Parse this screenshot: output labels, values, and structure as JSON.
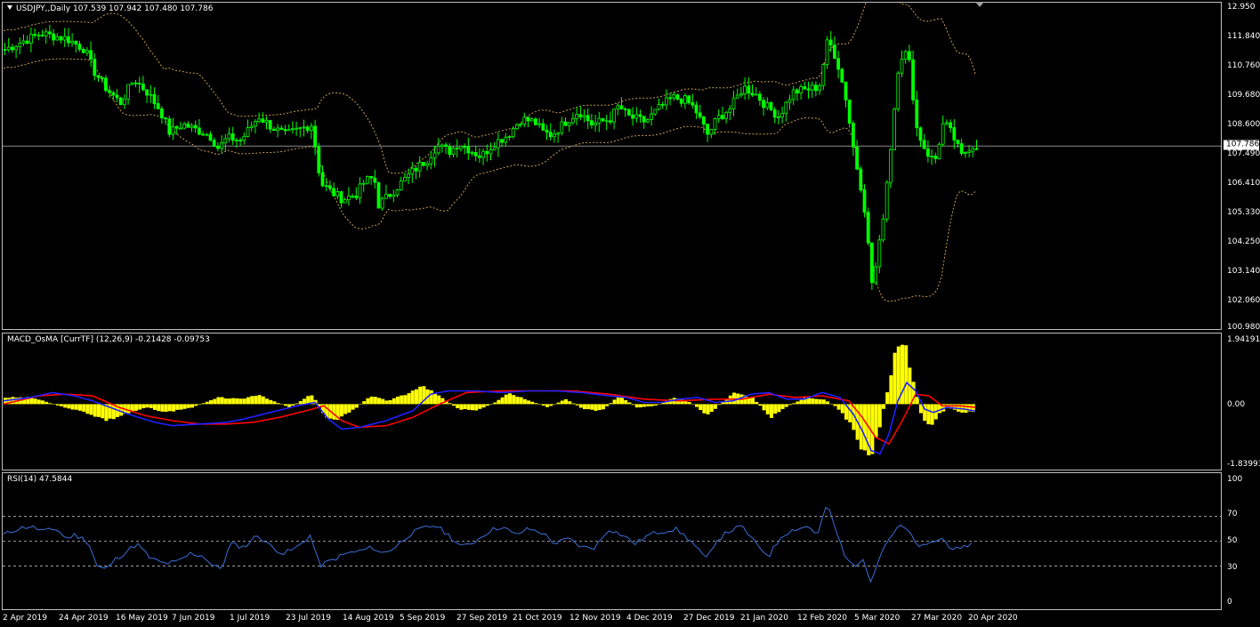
{
  "colors": {
    "background": "#000000",
    "frame": "#c0c0c0",
    "candle": "#00ff00",
    "bands": "#c8a050",
    "price_line": "#8a8a8a",
    "histogram": "#ffff00",
    "macd_line": "#2020ff",
    "signal_line": "#ff0000",
    "rsi_line": "#3a6fd8",
    "rsi_levels": "#c0c0c0"
  },
  "icons": {
    "symbol_menu": "triangle-down-icon",
    "chart_shift": "triangle-down-icon"
  },
  "main": {
    "title": "USDJPY,,Daily  107.539 107.942 107.480 107.786",
    "y_ticks": [
      "12.950",
      "111.840",
      "110.760",
      "109.680",
      "108.600",
      "107.490",
      "106.410",
      "105.330",
      "104.250",
      "103.140",
      "102.060",
      "100.980"
    ],
    "current_price": "107.786"
  },
  "macd": {
    "title": "MACD_OsMA [CurrTF] (12,26,9) -0.21428 -0.09753",
    "y_ticks": [
      "1.94191",
      "0.00",
      "-1.83993"
    ]
  },
  "rsi": {
    "title": "RSI(14) 47.5844",
    "y_ticks": [
      "100",
      "70",
      "50",
      "30",
      "0"
    ]
  },
  "x_ticks": [
    "2 Apr 2019",
    "24 Apr 2019",
    "16 May 2019",
    "7 Jun 2019",
    "1 Jul 2019",
    "23 Jul 2019",
    "14 Aug 2019",
    "5 Sep 2019",
    "27 Sep 2019",
    "21 Oct 2019",
    "12 Nov 2019",
    "4 Dec 2019",
    "27 Dec 2019",
    "21 Jan 2020",
    "12 Feb 2020",
    "5 Mar 2020",
    "27 Mar 2020",
    "20 Apr 2020"
  ],
  "chart_data": [
    {
      "type": "candlestick",
      "title": "USDJPY,,Daily  107.539 107.942 107.480 107.786",
      "symbol": "USDJPY",
      "timeframe": "Daily",
      "last_bar": {
        "open": 107.539,
        "high": 107.942,
        "low": 107.48,
        "close": 107.786
      },
      "ylim": [
        100.98,
        112.95
      ],
      "bollinger_bands": true,
      "x": [
        "2 Apr 2019",
        "24 Apr 2019",
        "16 May 2019",
        "7 Jun 2019",
        "1 Jul 2019",
        "23 Jul 2019",
        "14 Aug 2019",
        "5 Sep 2019",
        "27 Sep 2019",
        "21 Oct 2019",
        "12 Nov 2019",
        "4 Dec 2019",
        "27 Dec 2019",
        "21 Jan 2020",
        "12 Feb 2020",
        "5 Mar 2020",
        "27 Mar 2020",
        "20 Apr 2020"
      ],
      "close_approx": [
        111.5,
        111.9,
        110.2,
        108.4,
        108.5,
        108.2,
        106.2,
        106.9,
        107.8,
        108.6,
        108.8,
        108.7,
        109.4,
        109.9,
        109.9,
        107.6,
        107.9,
        107.8
      ],
      "close_path": [
        [
          0,
          111.4
        ],
        [
          20,
          111.7
        ],
        [
          40,
          112.0
        ],
        [
          55,
          111.9
        ],
        [
          70,
          111.8
        ],
        [
          90,
          111.4
        ],
        [
          100,
          110.6
        ],
        [
          115,
          109.9
        ],
        [
          130,
          109.4
        ],
        [
          145,
          110.3
        ],
        [
          160,
          109.8
        ],
        [
          175,
          109.1
        ],
        [
          185,
          108.3
        ],
        [
          200,
          108.6
        ],
        [
          215,
          108.4
        ],
        [
          230,
          108.2
        ],
        [
          240,
          107.7
        ],
        [
          250,
          108.1
        ],
        [
          265,
          108.0
        ],
        [
          285,
          108.9
        ],
        [
          300,
          108.5
        ],
        [
          315,
          108.2
        ],
        [
          330,
          108.4
        ],
        [
          345,
          108.6
        ],
        [
          355,
          106.4
        ],
        [
          370,
          106.0
        ],
        [
          380,
          105.8
        ],
        [
          395,
          106.0
        ],
        [
          405,
          106.5
        ],
        [
          415,
          106.6
        ],
        [
          420,
          105.6
        ],
        [
          430,
          105.9
        ],
        [
          445,
          106.4
        ],
        [
          460,
          106.9
        ],
        [
          475,
          107.3
        ],
        [
          485,
          107.8
        ],
        [
          500,
          107.6
        ],
        [
          510,
          107.9
        ],
        [
          525,
          107.6
        ],
        [
          535,
          107.4
        ],
        [
          550,
          107.9
        ],
        [
          565,
          108.2
        ],
        [
          580,
          108.8
        ],
        [
          595,
          108.7
        ],
        [
          605,
          108.3
        ],
        [
          615,
          108.2
        ],
        [
          630,
          108.7
        ],
        [
          645,
          109.1
        ],
        [
          660,
          108.6
        ],
        [
          680,
          108.8
        ],
        [
          690,
          109.3
        ],
        [
          700,
          108.9
        ],
        [
          720,
          108.7
        ],
        [
          735,
          109.2
        ],
        [
          750,
          109.6
        ],
        [
          765,
          109.5
        ],
        [
          775,
          109.2
        ],
        [
          790,
          108.2
        ],
        [
          800,
          108.8
        ],
        [
          815,
          109.2
        ],
        [
          830,
          110.0
        ],
        [
          845,
          109.7
        ],
        [
          855,
          109.3
        ],
        [
          870,
          108.9
        ],
        [
          885,
          109.8
        ],
        [
          900,
          109.9
        ],
        [
          915,
          110.0
        ],
        [
          925,
          111.8
        ],
        [
          935,
          111.0
        ],
        [
          945,
          109.6
        ],
        [
          955,
          107.4
        ],
        [
          965,
          105.8
        ],
        [
          975,
          102.5
        ],
        [
          985,
          104.6
        ],
        [
          995,
          107.6
        ],
        [
          1005,
          111.1
        ],
        [
          1015,
          111.3
        ],
        [
          1025,
          108.4
        ],
        [
          1035,
          107.6
        ],
        [
          1045,
          107.2
        ],
        [
          1055,
          108.7
        ],
        [
          1065,
          108.2
        ],
        [
          1075,
          107.4
        ],
        [
          1085,
          107.8
        ],
        [
          1092,
          107.79
        ]
      ]
    },
    {
      "type": "bar",
      "title": "MACD_OsMA [CurrTF] (12,26,9) -0.21428 -0.09753",
      "macd_value": -0.21428,
      "signal_value": -0.09753,
      "ylim": [
        -1.83993,
        1.94191
      ],
      "osma_path": [
        [
          0,
          0.2
        ],
        [
          30,
          0.2
        ],
        [
          60,
          -0.05
        ],
        [
          90,
          -0.25
        ],
        [
          115,
          -0.5
        ],
        [
          135,
          -0.3
        ],
        [
          160,
          -0.1
        ],
        [
          180,
          -0.25
        ],
        [
          210,
          -0.1
        ],
        [
          240,
          0.2
        ],
        [
          265,
          0.15
        ],
        [
          285,
          0.3
        ],
        [
          300,
          0.1
        ],
        [
          320,
          -0.1
        ],
        [
          345,
          0.3
        ],
        [
          360,
          -0.4
        ],
        [
          375,
          -0.45
        ],
        [
          395,
          -0.1
        ],
        [
          410,
          0.25
        ],
        [
          430,
          0.1
        ],
        [
          450,
          0.3
        ],
        [
          470,
          0.55
        ],
        [
          490,
          0.2
        ],
        [
          510,
          -0.15
        ],
        [
          530,
          -0.2
        ],
        [
          550,
          0.05
        ],
        [
          565,
          0.35
        ],
        [
          590,
          0.1
        ],
        [
          610,
          -0.1
        ],
        [
          630,
          0.15
        ],
        [
          650,
          -0.15
        ],
        [
          670,
          -0.2
        ],
        [
          690,
          0.25
        ],
        [
          710,
          -0.1
        ],
        [
          730,
          -0.05
        ],
        [
          750,
          0.2
        ],
        [
          770,
          0.05
        ],
        [
          790,
          -0.35
        ],
        [
          805,
          0.05
        ],
        [
          820,
          0.35
        ],
        [
          840,
          0.2
        ],
        [
          860,
          -0.4
        ],
        [
          880,
          -0.05
        ],
        [
          900,
          0.2
        ],
        [
          920,
          0.15
        ],
        [
          935,
          -0.1
        ],
        [
          950,
          -0.6
        ],
        [
          960,
          -1.2
        ],
        [
          970,
          -1.7
        ],
        [
          980,
          -1.0
        ],
        [
          990,
          0.2
        ],
        [
          1000,
          1.6
        ],
        [
          1010,
          1.9
        ],
        [
          1020,
          0.8
        ],
        [
          1030,
          -0.4
        ],
        [
          1040,
          -0.65
        ],
        [
          1050,
          -0.3
        ],
        [
          1060,
          -0.1
        ],
        [
          1075,
          -0.25
        ],
        [
          1092,
          -0.22
        ]
      ],
      "macd_path": [
        [
          0,
          0.1
        ],
        [
          30,
          0.2
        ],
        [
          55,
          0.35
        ],
        [
          80,
          0.25
        ],
        [
          100,
          0.1
        ],
        [
          120,
          -0.1
        ],
        [
          140,
          -0.3
        ],
        [
          170,
          -0.55
        ],
        [
          190,
          -0.65
        ],
        [
          220,
          -0.6
        ],
        [
          250,
          -0.55
        ],
        [
          270,
          -0.45
        ],
        [
          300,
          -0.25
        ],
        [
          330,
          -0.05
        ],
        [
          350,
          0.05
        ],
        [
          365,
          -0.45
        ],
        [
          380,
          -0.75
        ],
        [
          400,
          -0.7
        ],
        [
          430,
          -0.5
        ],
        [
          460,
          -0.2
        ],
        [
          480,
          0.3
        ],
        [
          500,
          0.4
        ],
        [
          530,
          0.4
        ],
        [
          560,
          0.35
        ],
        [
          590,
          0.4
        ],
        [
          620,
          0.4
        ],
        [
          650,
          0.35
        ],
        [
          680,
          0.25
        ],
        [
          700,
          0.2
        ],
        [
          720,
          0.05
        ],
        [
          740,
          0.05
        ],
        [
          760,
          0.15
        ],
        [
          780,
          0.2
        ],
        [
          800,
          0.05
        ],
        [
          820,
          0.1
        ],
        [
          840,
          0.3
        ],
        [
          860,
          0.35
        ],
        [
          880,
          0.15
        ],
        [
          900,
          0.15
        ],
        [
          920,
          0.35
        ],
        [
          940,
          0.2
        ],
        [
          955,
          -0.3
        ],
        [
          965,
          -0.8
        ],
        [
          975,
          -1.4
        ],
        [
          985,
          -1.5
        ],
        [
          995,
          -0.9
        ],
        [
          1005,
          0.1
        ],
        [
          1015,
          0.65
        ],
        [
          1025,
          0.4
        ],
        [
          1035,
          -0.15
        ],
        [
          1045,
          -0.25
        ],
        [
          1060,
          -0.1
        ],
        [
          1080,
          -0.15
        ],
        [
          1092,
          -0.21
        ]
      ],
      "signal_path": [
        [
          0,
          0.0
        ],
        [
          40,
          0.25
        ],
        [
          70,
          0.3
        ],
        [
          100,
          0.25
        ],
        [
          130,
          -0.1
        ],
        [
          160,
          -0.35
        ],
        [
          190,
          -0.5
        ],
        [
          220,
          -0.6
        ],
        [
          250,
          -0.6
        ],
        [
          280,
          -0.55
        ],
        [
          310,
          -0.4
        ],
        [
          340,
          -0.2
        ],
        [
          360,
          -0.05
        ],
        [
          380,
          -0.5
        ],
        [
          400,
          -0.7
        ],
        [
          430,
          -0.65
        ],
        [
          460,
          -0.4
        ],
        [
          490,
          0.0
        ],
        [
          520,
          0.35
        ],
        [
          560,
          0.4
        ],
        [
          600,
          0.4
        ],
        [
          640,
          0.4
        ],
        [
          680,
          0.3
        ],
        [
          720,
          0.15
        ],
        [
          760,
          0.1
        ],
        [
          800,
          0.15
        ],
        [
          830,
          0.15
        ],
        [
          860,
          0.3
        ],
        [
          890,
          0.2
        ],
        [
          920,
          0.25
        ],
        [
          950,
          0.1
        ],
        [
          965,
          -0.4
        ],
        [
          980,
          -1.0
        ],
        [
          995,
          -1.2
        ],
        [
          1010,
          -0.5
        ],
        [
          1025,
          0.3
        ],
        [
          1040,
          0.25
        ],
        [
          1055,
          -0.05
        ],
        [
          1075,
          -0.05
        ],
        [
          1092,
          -0.1
        ]
      ]
    },
    {
      "type": "line",
      "title": "RSI(14) 47.5844",
      "value": 47.5844,
      "ylim": [
        0,
        100
      ],
      "levels": [
        70,
        50,
        30
      ],
      "rsi_path": [
        [
          0,
          55
        ],
        [
          15,
          60
        ],
        [
          30,
          62
        ],
        [
          45,
          58
        ],
        [
          60,
          60
        ],
        [
          70,
          52
        ],
        [
          80,
          55
        ],
        [
          95,
          50
        ],
        [
          105,
          30
        ],
        [
          115,
          27
        ],
        [
          125,
          35
        ],
        [
          135,
          40
        ],
        [
          150,
          48
        ],
        [
          165,
          36
        ],
        [
          180,
          32
        ],
        [
          195,
          33
        ],
        [
          210,
          40
        ],
        [
          225,
          38
        ],
        [
          235,
          30
        ],
        [
          245,
          28
        ],
        [
          255,
          48
        ],
        [
          270,
          45
        ],
        [
          285,
          55
        ],
        [
          300,
          46
        ],
        [
          315,
          40
        ],
        [
          330,
          45
        ],
        [
          345,
          55
        ],
        [
          355,
          30
        ],
        [
          370,
          35
        ],
        [
          385,
          40
        ],
        [
          400,
          42
        ],
        [
          415,
          45
        ],
        [
          425,
          40
        ],
        [
          440,
          45
        ],
        [
          455,
          55
        ],
        [
          470,
          60
        ],
        [
          485,
          63
        ],
        [
          500,
          55
        ],
        [
          515,
          45
        ],
        [
          530,
          50
        ],
        [
          545,
          58
        ],
        [
          560,
          62
        ],
        [
          575,
          55
        ],
        [
          590,
          60
        ],
        [
          605,
          57
        ],
        [
          620,
          48
        ],
        [
          635,
          52
        ],
        [
          650,
          45
        ],
        [
          665,
          45
        ],
        [
          680,
          60
        ],
        [
          695,
          55
        ],
        [
          710,
          48
        ],
        [
          725,
          55
        ],
        [
          740,
          58
        ],
        [
          755,
          60
        ],
        [
          770,
          52
        ],
        [
          790,
          35
        ],
        [
          800,
          50
        ],
        [
          815,
          58
        ],
        [
          830,
          62
        ],
        [
          845,
          48
        ],
        [
          860,
          38
        ],
        [
          875,
          55
        ],
        [
          890,
          60
        ],
        [
          905,
          62
        ],
        [
          915,
          55
        ],
        [
          925,
          80
        ],
        [
          935,
          60
        ],
        [
          945,
          38
        ],
        [
          955,
          30
        ],
        [
          965,
          35
        ],
        [
          975,
          18
        ],
        [
          985,
          40
        ],
        [
          995,
          52
        ],
        [
          1005,
          62
        ],
        [
          1015,
          60
        ],
        [
          1025,
          48
        ],
        [
          1035,
          45
        ],
        [
          1045,
          50
        ],
        [
          1055,
          52
        ],
        [
          1065,
          45
        ],
        [
          1075,
          42
        ],
        [
          1085,
          48
        ],
        [
          1092,
          47.58
        ]
      ]
    }
  ]
}
